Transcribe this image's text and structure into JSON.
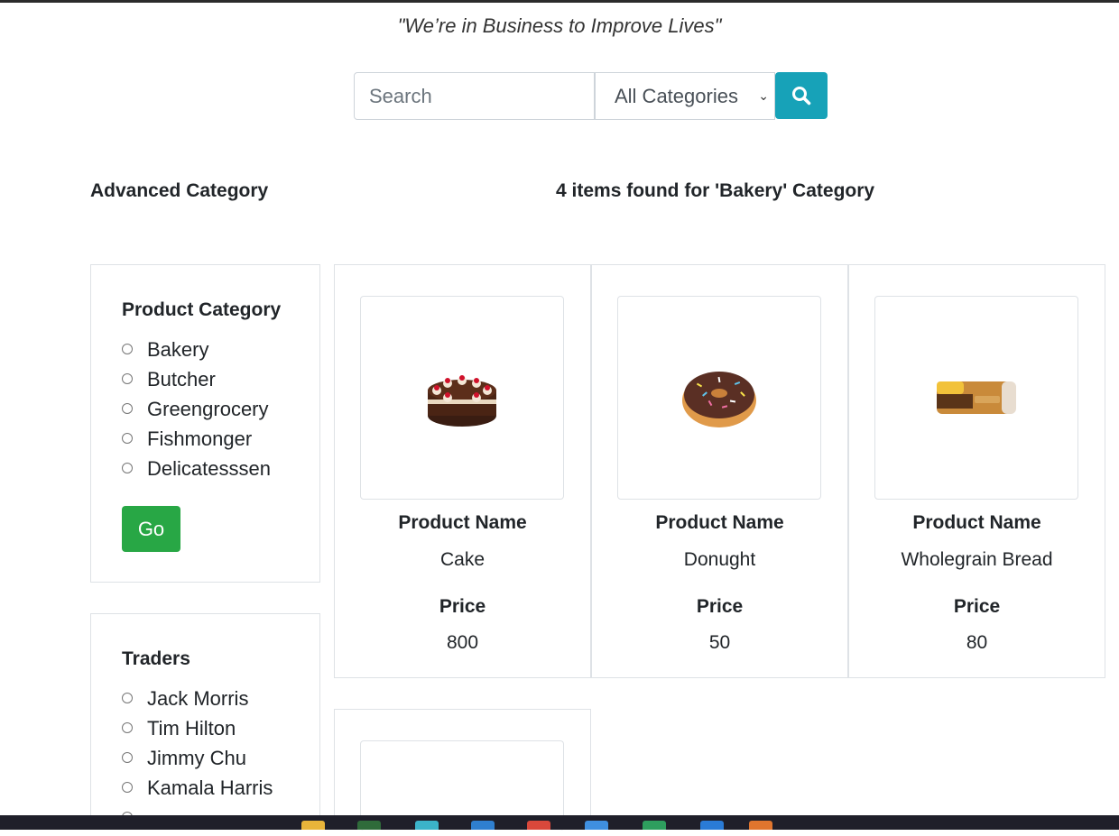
{
  "tagline": "\"We’re in Business to Improve Lives\"",
  "search": {
    "placeholder": "Search",
    "category_selected": "All Categories"
  },
  "sidebar": {
    "heading": "Advanced Category",
    "product_category": {
      "title": "Product Category",
      "options": [
        "Bakery",
        "Butcher",
        "Greengrocery",
        "Fishmonger",
        "Delicatesssen"
      ],
      "go_label": "Go"
    },
    "traders": {
      "title": "Traders",
      "options": [
        "Jack Morris",
        "Tim Hilton",
        "Jimmy Chu",
        "Kamala Harris"
      ]
    }
  },
  "results": {
    "heading": "4 items found for 'Bakery' Category",
    "name_label": "Product Name",
    "price_label": "Price",
    "products": [
      {
        "name": "Cake",
        "price": "800",
        "icon": "cake-image"
      },
      {
        "name": "Donught",
        "price": "50",
        "icon": "donut-image"
      },
      {
        "name": "Wholegrain Bread",
        "price": "80",
        "icon": "bread-image"
      }
    ]
  },
  "colors": {
    "accent": "#17a2b8",
    "go": "#28a745",
    "border": "#dee2e6"
  }
}
